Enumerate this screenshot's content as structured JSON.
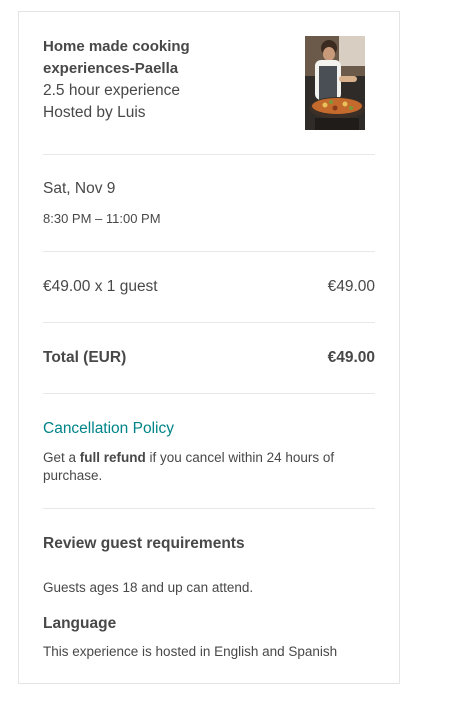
{
  "experience": {
    "title_line1": "Home made cooking",
    "title_line2": "experiences-Paella",
    "duration": "2.5 hour experience",
    "host": "Hosted by Luis",
    "thumbnail_icon": "paella-cooking-photo"
  },
  "schedule": {
    "date": "Sat, Nov 9",
    "time": "8:30 PM – 11:00 PM"
  },
  "pricing": {
    "line_label": "€49.00 x 1 guest",
    "line_amount": "€49.00",
    "total_label": "Total (EUR)",
    "total_amount": "€49.00"
  },
  "cancellation": {
    "link_label": "Cancellation Policy",
    "text_prefix": "Get a ",
    "text_bold": "full refund",
    "text_suffix": " if you cancel within 24 hours of purchase."
  },
  "requirements": {
    "title": "Review guest requirements",
    "age_text": "Guests ages 18 and up can attend.",
    "language_title": "Language",
    "language_text": "This experience is hosted in English and Spanish"
  },
  "colors": {
    "link": "#008489",
    "text": "#484848",
    "border": "#e4e4e4"
  }
}
